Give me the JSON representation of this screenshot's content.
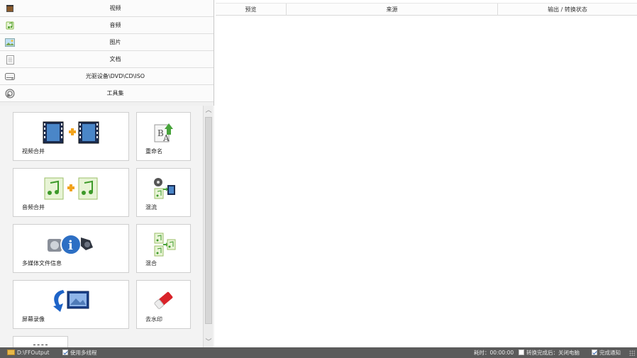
{
  "categories": [
    {
      "label": "视频",
      "icon": "film-icon"
    },
    {
      "label": "音频",
      "icon": "music-note-icon"
    },
    {
      "label": "图片",
      "icon": "picture-icon"
    },
    {
      "label": "文档",
      "icon": "document-icon"
    },
    {
      "label": "光驱设备\\DVD\\CD\\ISO",
      "icon": "optical-drive-icon"
    },
    {
      "label": "工具集",
      "icon": "toolbox-icon"
    }
  ],
  "tools": [
    {
      "label": "视频合并",
      "icon": "video-merge-icon"
    },
    {
      "label": "重命名",
      "icon": "rename-icon"
    },
    {
      "label": "音频合并",
      "icon": "audio-merge-icon"
    },
    {
      "label": "混流",
      "icon": "mux-icon"
    },
    {
      "label": "多媒体文件信息",
      "icon": "media-info-icon"
    },
    {
      "label": "混合",
      "icon": "mix-icon"
    },
    {
      "label": "屏幕录像",
      "icon": "screen-record-icon"
    },
    {
      "label": "去水印",
      "icon": "remove-watermark-icon"
    }
  ],
  "table": {
    "columns": [
      "预览",
      "来源",
      "输出 / 转换状态"
    ],
    "rows": []
  },
  "status": {
    "output_path": "D:\\FFOutput",
    "multithread_label": "使用多线程",
    "multithread_checked": true,
    "elapsed": "耗时：00:00:00",
    "after_convert_label": "转换完成后：关闭电脑",
    "after_convert_checked": false,
    "notify_label": "完成通知",
    "notify_checked": true
  },
  "colors": {
    "statusbar": "#5b5b5b",
    "accent_blue": "#2a5fb0"
  }
}
